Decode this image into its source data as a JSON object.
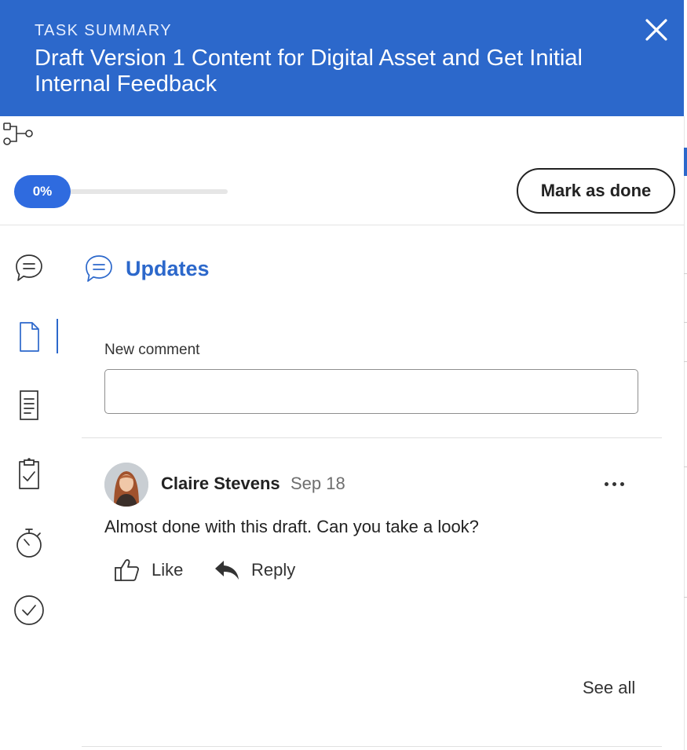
{
  "header": {
    "eyebrow": "TASK SUMMARY",
    "title": "Draft Version 1 Content for Digital Asset and Get Initial Internal Feedback",
    "close_icon": "close-icon",
    "background_color": "#2c68cb"
  },
  "workflow": {
    "icon": "workflow-branch-icon"
  },
  "progress": {
    "label": "0%",
    "value": 0
  },
  "actions": {
    "mark_done_label": "Mark as done"
  },
  "rail": {
    "items": [
      {
        "name": "updates",
        "icon": "chat-bubble-icon"
      },
      {
        "name": "documents",
        "icon": "document-icon",
        "active": true
      },
      {
        "name": "details",
        "icon": "notes-icon"
      },
      {
        "name": "approvals",
        "icon": "clipboard-check-icon"
      },
      {
        "name": "time",
        "icon": "stopwatch-icon"
      },
      {
        "name": "completion",
        "icon": "check-circle-icon"
      }
    ]
  },
  "updates": {
    "title": "Updates",
    "new_comment_label": "New comment",
    "new_comment_value": "",
    "comments": [
      {
        "author": "Claire Stevens",
        "date": "Sep 18",
        "text": "Almost done with this draft. Can you take a look?",
        "like_label": "Like",
        "reply_label": "Reply"
      }
    ],
    "see_all_label": "See all"
  },
  "colors": {
    "accent": "#2c68cb",
    "pill": "#2f6bdf"
  }
}
